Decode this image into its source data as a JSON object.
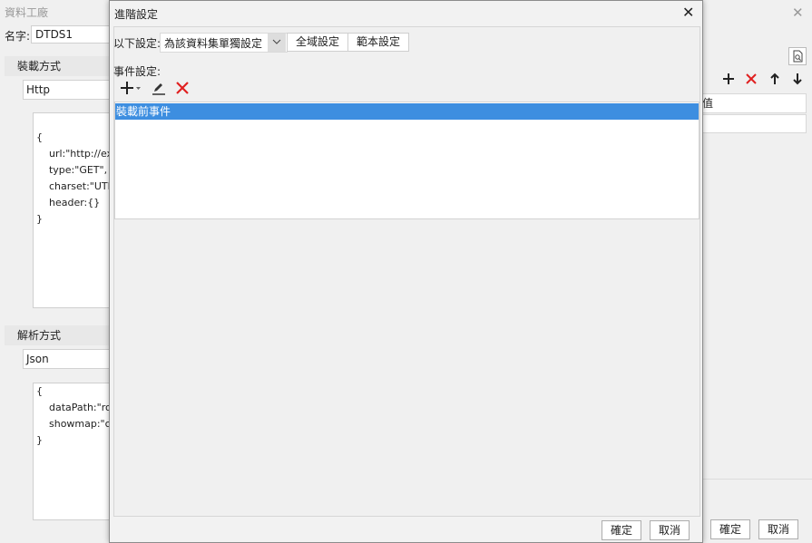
{
  "background_window": {
    "title": "資料工廠",
    "name_label": "名字:",
    "name_value": "DTDS1",
    "load_section": {
      "heading": "裝載方式",
      "method": "Http",
      "code_lines": [
        "",
        "{",
        "    url:\"http://exa",
        "    type:\"GET\",",
        "    charset:\"UTF",
        "    header:{}",
        "}"
      ]
    },
    "parse_section": {
      "heading": "解析方式",
      "method": "Json",
      "code_lines": [
        "{",
        "    dataPath:\"ro",
        "    showmap:\"c",
        "}"
      ]
    },
    "right_panel": {
      "cell_text": "值",
      "icons": [
        "add-icon",
        "delete-icon",
        "up-arrow-icon",
        "down-arrow-icon",
        "preview-icon"
      ]
    },
    "footer": {
      "ok": "確定",
      "cancel": "取消"
    }
  },
  "dialog": {
    "title": "進階設定",
    "scope_label": "以下設定:",
    "scope_value": "為該資料集單獨設定",
    "tabs": [
      "全域設定",
      "範本設定"
    ],
    "events_label": "事件設定:",
    "toolbar_icons": [
      "add-icon",
      "edit-icon",
      "delete-icon"
    ],
    "events": [
      "裝載前事件"
    ],
    "footer": {
      "ok": "確定",
      "cancel": "取消"
    }
  },
  "colors": {
    "selection": "#3d8ee0",
    "delete": "#e02020"
  }
}
